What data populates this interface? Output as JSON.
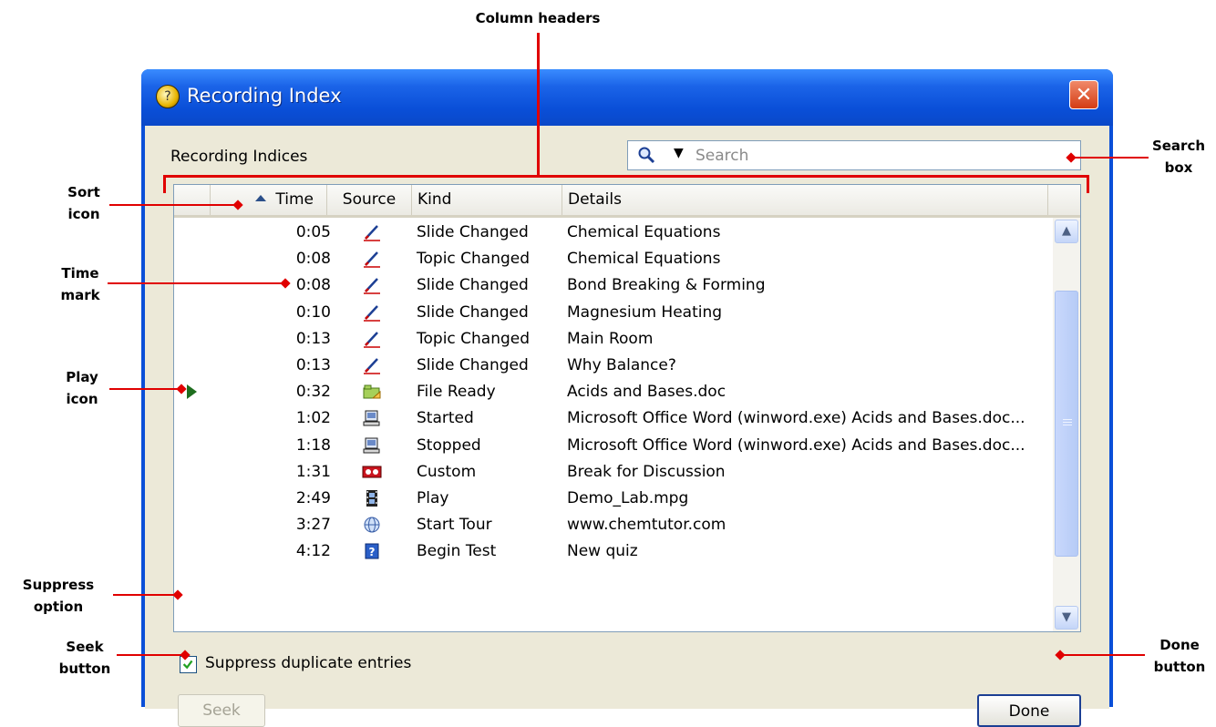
{
  "window": {
    "title": "Recording Index",
    "close_glyph": "✕"
  },
  "labels": {
    "recording_indices": "Recording Indices"
  },
  "search": {
    "placeholder": "Search",
    "dropdown_glyph": "▼"
  },
  "columns": [
    "Time",
    "Source",
    "Kind",
    "Details"
  ],
  "rows": [
    {
      "time": "0:05",
      "source_icon": "pen-icon",
      "kind": "Slide Changed",
      "details": "Chemical Equations"
    },
    {
      "time": "0:08",
      "source_icon": "pen-icon",
      "kind": "Topic Changed",
      "details": "Chemical Equations"
    },
    {
      "time": "0:08",
      "source_icon": "pen-icon",
      "kind": "Slide Changed",
      "details": "Bond Breaking & Forming"
    },
    {
      "time": "0:10",
      "source_icon": "pen-icon",
      "kind": "Slide Changed",
      "details": "Magnesium Heating"
    },
    {
      "time": "0:13",
      "source_icon": "pen-icon",
      "kind": "Topic Changed",
      "details": "Main Room"
    },
    {
      "time": "0:13",
      "source_icon": "pen-icon",
      "kind": "Slide Changed",
      "details": "Why Balance?"
    },
    {
      "time": "0:32",
      "source_icon": "folder-icon",
      "kind": "File Ready",
      "details": "Acids and Bases.doc",
      "playing": true
    },
    {
      "time": "1:02",
      "source_icon": "computer-icon",
      "kind": "Started",
      "details": "Microsoft Office Word (winword.exe) Acids and Bases.doc..."
    },
    {
      "time": "1:18",
      "source_icon": "computer-icon",
      "kind": "Stopped",
      "details": "Microsoft Office Word (winword.exe) Acids and Bases.doc..."
    },
    {
      "time": "1:31",
      "source_icon": "custom-icon",
      "kind": "Custom",
      "details": "Break for Discussion"
    },
    {
      "time": "2:49",
      "source_icon": "film-icon",
      "kind": "Play",
      "details": "Demo_Lab.mpg"
    },
    {
      "time": "3:27",
      "source_icon": "globe-icon",
      "kind": "Start Tour",
      "details": "www.chemtutor.com"
    },
    {
      "time": "4:12",
      "source_icon": "quiz-icon",
      "kind": "Begin Test",
      "details": "New quiz"
    }
  ],
  "suppress": {
    "label": "Suppress duplicate entries",
    "checked": true
  },
  "buttons": {
    "seek": "Seek",
    "done": "Done"
  },
  "callouts": {
    "column_headers": "Column headers",
    "search_box": "Search box",
    "sort_icon": "Sort icon",
    "time_mark": "Time mark",
    "play_icon": "Play icon",
    "suppress_option": "Suppress option",
    "seek_button": "Seek button",
    "done_button": "Done button"
  },
  "colors": {
    "callout": "#e00000",
    "titlebar": "#0a4fd8",
    "client": "#ece9d8"
  }
}
